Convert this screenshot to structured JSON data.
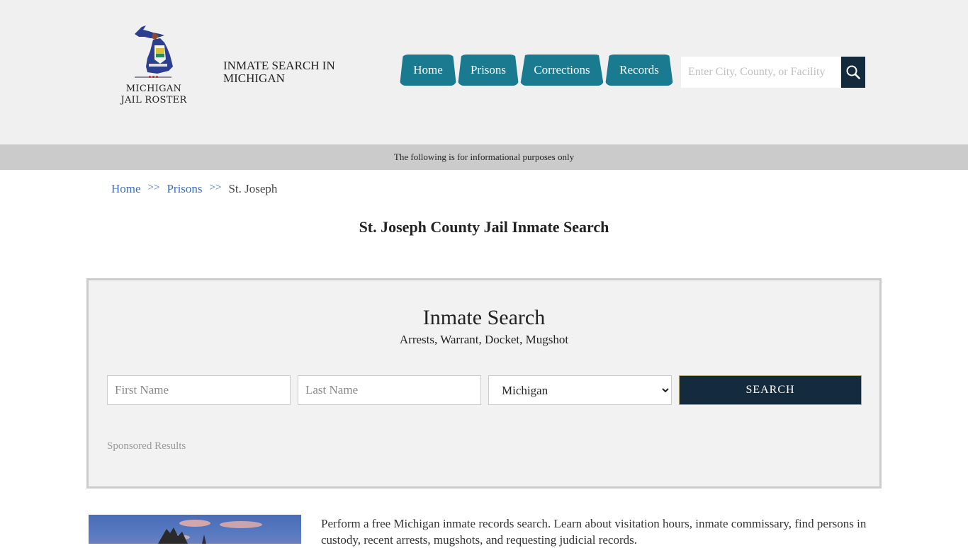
{
  "logo": {
    "line1": "MICHIGAN",
    "line2": "JAIL ROSTER",
    "icon": "michigan-map-icon"
  },
  "site_title": {
    "line1": "INMATE SEARCH IN",
    "line2": "MICHIGAN"
  },
  "nav": {
    "items": [
      {
        "label": "Home"
      },
      {
        "label": "Prisons"
      },
      {
        "label": "Corrections"
      },
      {
        "label": "Records"
      }
    ]
  },
  "site_search": {
    "placeholder": "Enter City, County, or Facility",
    "value": "",
    "icon": "search-icon"
  },
  "info_bar": {
    "text": "The following is for informational purposes only"
  },
  "breadcrumb": {
    "items": [
      {
        "label": "Home"
      },
      {
        "label": "Prisons"
      },
      {
        "label": "St. Joseph"
      }
    ],
    "separator": ">>"
  },
  "page_title": "St. Joseph County Jail Inmate Search",
  "search_panel": {
    "title": "Inmate Search",
    "subtitle": "Arrests, Warrant, Docket, Mugshot",
    "first_name_placeholder": "First Name",
    "last_name_placeholder": "Last Name",
    "state_selected": "Michigan",
    "submit_label": "SEARCH",
    "sponsored_label": "Sponsored Results"
  },
  "intro": {
    "text": "Perform a free Michigan inmate records search. Learn about visitation hours, inmate commissary, find persons in custody, recent arrests, mugshots, and requesting judicial records."
  },
  "colors": {
    "nav_bg": "#1a7a8f",
    "dark_navy": "#142b3d",
    "link_blue": "#3a6fc4",
    "header_bg": "#f0f0f0",
    "info_bar_bg": "#cbcbcb"
  }
}
